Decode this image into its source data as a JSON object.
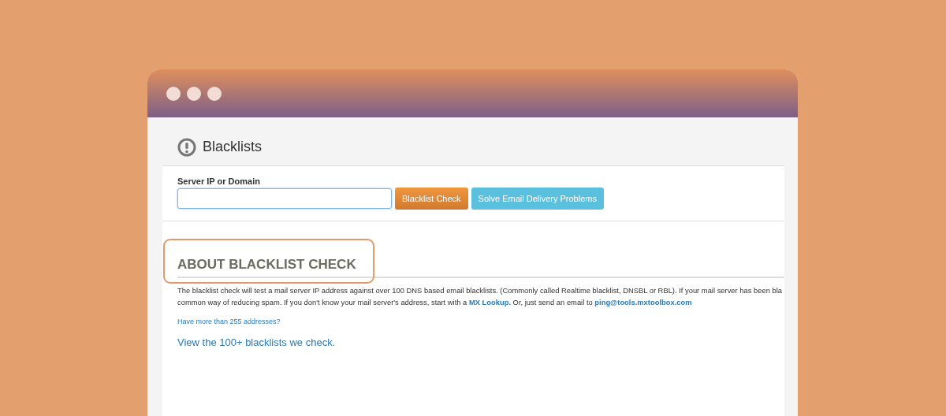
{
  "page": {
    "title": "Blacklists"
  },
  "form": {
    "label": "Server IP or Domain",
    "buttons": [
      {
        "label": "Blacklist Check",
        "kind": "primary"
      },
      {
        "label": "Solve Email Delivery Problems",
        "kind": "info"
      }
    ]
  },
  "about": {
    "heading": "ABOUT BLACKLIST CHECK",
    "line_1": "The blacklist check will test a mail server IP address against over 100 DNS based email blacklists. (Commonly called Realtime blacklist, DNSBL or RBL).  If your mail server has been bla",
    "line_2_before": "common way of reducing spam.  If you don't know your mail server's address, start with a ",
    "line_2_link": "MX Lookup.",
    "line_2_middle": "   Or, just send an email to ",
    "line_2_email": "ping@tools.mxtoolbox.com",
    "small_link": "Have more than 255 addresses?",
    "big_link": "View the 100+ blacklists we check."
  }
}
